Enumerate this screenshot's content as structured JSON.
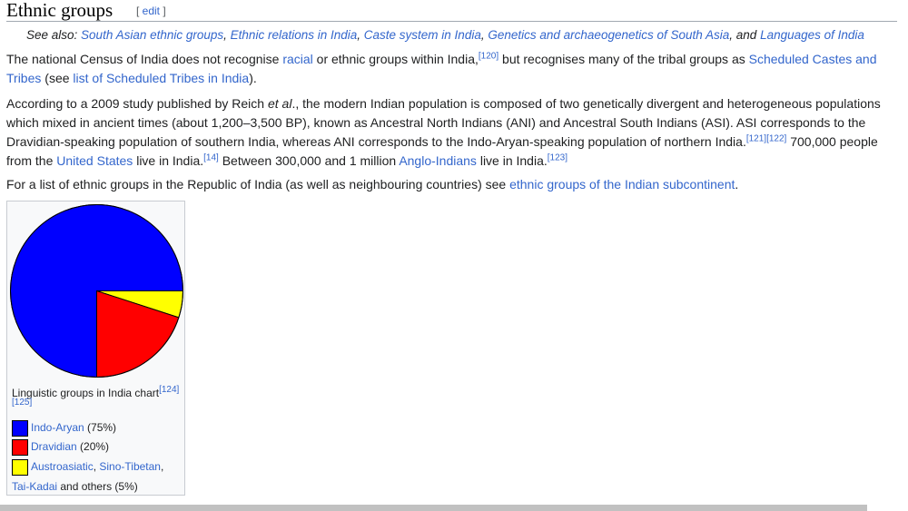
{
  "heading": {
    "title": "Ethnic groups",
    "edit_open": "[ ",
    "edit_label": "edit",
    "edit_close": " ]"
  },
  "hatnote": {
    "prefix": "See also: ",
    "links": [
      "South Asian ethnic groups",
      "Ethnic relations in India",
      "Caste system in India",
      "Genetics and archaeogenetics of South Asia",
      "Languages of India"
    ],
    "sep": ", ",
    "conj": ", and "
  },
  "p1": {
    "t1": "The national Census of India does not recognise ",
    "link_racial": "racial",
    "t2": " or ethnic groups within India,",
    "ref120": "[120]",
    "t3": " but recognises many of the tribal groups as ",
    "link_scheduled": "Scheduled Castes and Tribes",
    "t4": " (see ",
    "link_list": "list of Scheduled Tribes in India",
    "t5": ")."
  },
  "p2": {
    "t1": "According to a 2009 study published by Reich ",
    "etal": "et al",
    "t2": "., the modern Indian population is composed of two genetically divergent and heterogeneous populations which mixed in ancient times (about 1,200–3,500 BP), known as Ancestral North Indians (ANI) and Ancestral South Indians (ASI). ASI corresponds to the Dravidian-speaking population of southern India, whereas ANI corresponds to the Indo-Aryan-speaking population of northern India.",
    "ref121": "[121]",
    "ref122": "[122]",
    "t3": " 700,000 people from the ",
    "link_us": "United States",
    "t4": " live in India.",
    "ref14": "[14]",
    "t5": " Between 300,000 and 1 million ",
    "link_anglo": "Anglo-Indians",
    "t6": " live in India.",
    "ref123": "[123]"
  },
  "p3": {
    "t1": "For a list of ethnic groups in the Republic of India (as well as neighbouring countries) see ",
    "link": "ethnic groups of the Indian subcontinent",
    "t2": "."
  },
  "figure": {
    "caption": "Linguistic groups in India chart",
    "ref124": "[124]",
    "ref125": "[125]",
    "legend": [
      {
        "link": "Indo-Aryan",
        "rest": " (75%)",
        "color": "#0000ff"
      },
      {
        "link": "Dravidian",
        "rest": " (20%)",
        "color": "#ff0000"
      },
      {
        "link": "Austroasiatic",
        "sep1": ", ",
        "link2": "Sino-Tibetan",
        "sep2": ",",
        "link3": "Tai-Kadai",
        "rest": " and others (5%)",
        "color": "#ffff00"
      }
    ]
  },
  "chart_data": {
    "type": "pie",
    "categories": [
      "Indo-Aryan",
      "Dravidian",
      "Austroasiatic, Sino-Tibetan, Tai-Kadai and others"
    ],
    "values": [
      75,
      20,
      5
    ],
    "colors": [
      "#0000ff",
      "#ff0000",
      "#ffff00"
    ],
    "title": "Linguistic groups in India chart"
  }
}
